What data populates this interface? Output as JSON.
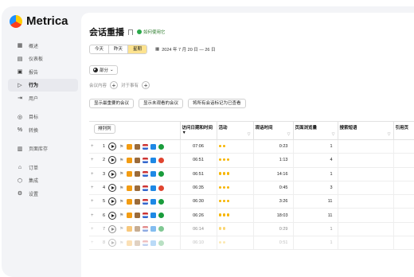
{
  "app": {
    "name": "Metrica"
  },
  "sidebar": {
    "items": [
      {
        "label": "概述",
        "icon": "grid-icon",
        "glyph": "▦"
      },
      {
        "label": "仪表板",
        "icon": "dashboard-icon",
        "glyph": "▤"
      },
      {
        "label": "报告",
        "icon": "reports-icon",
        "glyph": "▣"
      },
      {
        "label": "行为",
        "icon": "play-icon",
        "glyph": "▷",
        "active": true
      },
      {
        "label": "用户",
        "icon": "login-icon",
        "glyph": "⇥"
      },
      {
        "label": "目标",
        "icon": "target-icon",
        "glyph": "◎",
        "gap": true
      },
      {
        "label": "转换",
        "icon": "percent-icon",
        "glyph": "%"
      },
      {
        "label": "页面库存",
        "icon": "pages-icon",
        "glyph": "▥",
        "gap": true
      },
      {
        "label": "订单",
        "icon": "cart-icon",
        "glyph": "⌂",
        "gap": true
      },
      {
        "label": "集成",
        "icon": "integrations-icon",
        "glyph": "⬡"
      },
      {
        "label": "设置",
        "icon": "gear-icon",
        "glyph": "⚙"
      }
    ]
  },
  "header": {
    "title": "会话重播",
    "howto": "如何使用它"
  },
  "period": {
    "options": [
      "今天",
      "昨天",
      "星期"
    ],
    "selected": "星期",
    "range": "2024 年 7 月 20 日 — 26 日"
  },
  "segment": {
    "label": "部分"
  },
  "conditions": {
    "session_content": "会议内容",
    "thinking": "对于事有"
  },
  "quick_filters": [
    "显示最重要的会议",
    "显示未观看的会议",
    "将所有会话标记为已查看"
  ],
  "table": {
    "columns_button": "排列列",
    "headers": [
      "访问日期和时间",
      "活动",
      "观话时间",
      "页面浏览量",
      "搜索短语",
      "引用页"
    ],
    "rows": [
      {
        "n": "1",
        "time": "07:06",
        "activity": 2,
        "duration": "0:23",
        "views": "1",
        "browser": "#1a9c3c",
        "fade": 0
      },
      {
        "n": "2",
        "time": "06:51",
        "activity": 3,
        "duration": "1:13",
        "views": "4",
        "browser": "#e0442f",
        "fade": 0
      },
      {
        "n": "3",
        "time": "06:51",
        "activity": 3,
        "duration": "14:16",
        "views": "1",
        "browser": "#1a9c3c",
        "fade": 0
      },
      {
        "n": "4",
        "time": "06:35",
        "activity": 3,
        "duration": "0:45",
        "views": "3",
        "browser": "#e0442f",
        "fade": 0
      },
      {
        "n": "5",
        "time": "06:30",
        "activity": 3,
        "duration": "3:26",
        "views": "11",
        "browser": "#1a9c3c",
        "fade": 0
      },
      {
        "n": "6",
        "time": "06:26",
        "activity": 3,
        "duration": "18:03",
        "views": "11",
        "browser": "#1a9c3c",
        "fade": 0
      },
      {
        "n": "7",
        "time": "06:14",
        "activity": 2,
        "duration": "0:29",
        "views": "1",
        "browser": "#1a9c3c",
        "fade": 1
      },
      {
        "n": "8",
        "time": "06:10",
        "activity": 2,
        "duration": "0:51",
        "views": "1",
        "browser": "#1a9c3c",
        "fade": 2
      }
    ]
  },
  "colors": {
    "accent": "#fde38f",
    "activity_dot": "#f7b500",
    "activity_dim": "#f9d88a"
  }
}
